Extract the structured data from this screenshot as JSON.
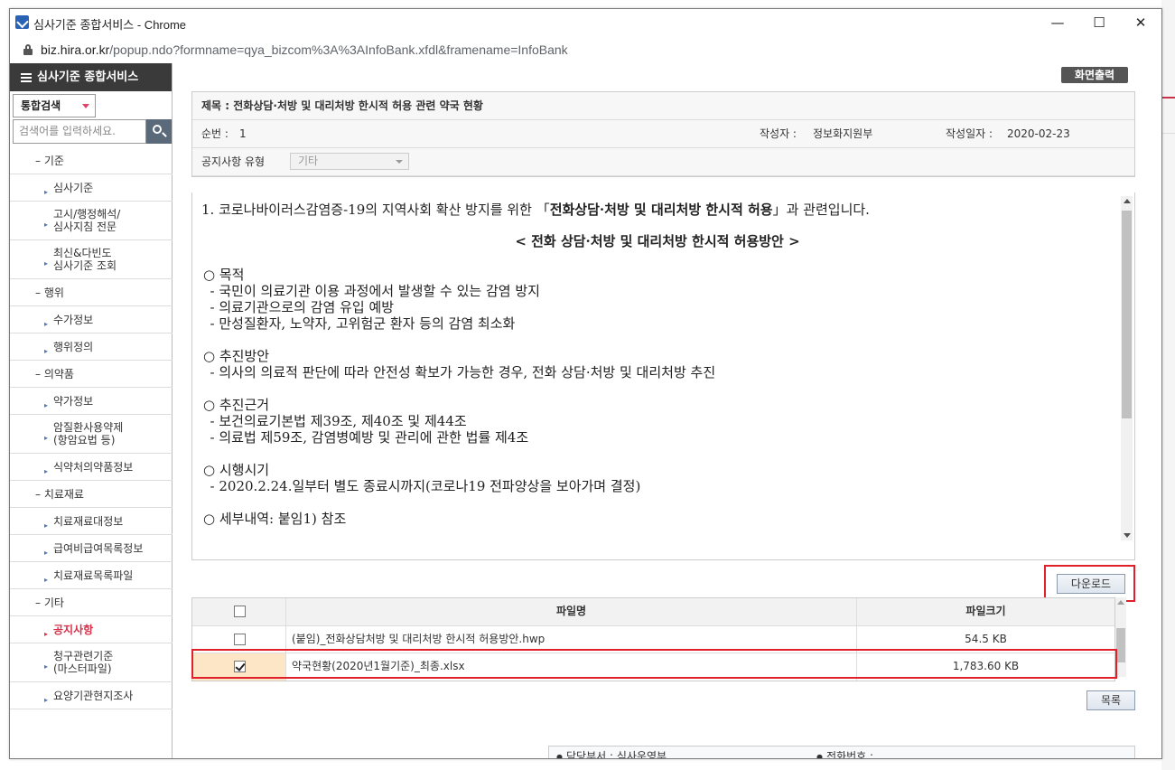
{
  "window": {
    "title": "심사기준 종합서비스 - Chrome",
    "url_host": "biz.hira.or.kr",
    "url_path": "/popup.ndo?formname=qya_bizcom%3A%3AInfoBank.xfdl&framename=InfoBank",
    "minimize": "—",
    "maximize": "☐",
    "close": "✕"
  },
  "sidebar": {
    "header": "심사기준 종합서비스",
    "search_type": "통합검색",
    "search_placeholder": "검색어를 입력하세요.",
    "items": [
      {
        "label": "– 기준",
        "kind": "cat"
      },
      {
        "label": "심사기준",
        "kind": "sub"
      },
      {
        "label": "고시/행정해석/\n심사지침 전문",
        "kind": "sub2"
      },
      {
        "label": "최신&다빈도\n심사기준 조회",
        "kind": "sub2"
      },
      {
        "label": "– 행위",
        "kind": "cat"
      },
      {
        "label": "수가정보",
        "kind": "sub"
      },
      {
        "label": "행위정의",
        "kind": "sub"
      },
      {
        "label": "– 의약품",
        "kind": "cat"
      },
      {
        "label": "약가정보",
        "kind": "sub"
      },
      {
        "label": "암질환사용약제\n(항암요법 등)",
        "kind": "sub2"
      },
      {
        "label": "식약처의약품정보",
        "kind": "sub"
      },
      {
        "label": "– 치료재료",
        "kind": "cat"
      },
      {
        "label": "치료재료대정보",
        "kind": "sub"
      },
      {
        "label": "급여비급여목록정보",
        "kind": "sub"
      },
      {
        "label": "치료재료목록파일",
        "kind": "sub"
      },
      {
        "label": "– 기타",
        "kind": "cat"
      },
      {
        "label": "공지사항",
        "kind": "sub",
        "active": true
      },
      {
        "label": "청구관련기준\n(마스터파일)",
        "kind": "sub2"
      },
      {
        "label": "요양기관현지조사",
        "kind": "sub"
      }
    ]
  },
  "main": {
    "print_button": "화면출력",
    "title_label": "제목 :",
    "title_value": "전화상담·처방 및 대리처방 한시적 허용 관련 약국 현황",
    "seq_label": "순번 :",
    "seq_value": "1",
    "author_label": "작성자 :",
    "author_value": "정보화지원부",
    "date_label": "작성일자 :",
    "date_value": "2020-02-23",
    "notice_type_label": "공지사항 유형",
    "notice_type_value": "기타",
    "body": {
      "line1_pre": "1. 코로나바이러스감염증-19의 지역사회 확산 방지를 위한 「",
      "line1_bold": "전화상담·처방 및 대리처방 한시적 허용",
      "line1_post": "」과 관련입니다.",
      "heading": "< 전화 상담·처방 및 대리처방 한시적 허용방안 >",
      "s1_title": "○ 목적",
      "s1_l1": "  - 국민이 의료기관 이용 과정에서 발생할 수 있는 감염 방지",
      "s1_l2": "  - 의료기관으로의 감염 유입 예방",
      "s1_l3": "  - 만성질환자, 노약자, 고위험군 환자 등의 감염 최소화",
      "s2_title": "○ 추진방안",
      "s2_l1": "  - 의사의 의료적 판단에 따라 안전성 확보가 가능한 경우, 전화 상담·처방 및 대리처방 추진",
      "s3_title": "○ 추진근거",
      "s3_l1": "  - 보건의료기본법 제39조, 제40조 및 제44조",
      "s3_l2": "  - 의료법 제59조, 감염병예방 및 관리에 관한 법률 제4조",
      "s4_title": "○ 시행시기",
      "s4_l1": "  - 2020.2.24.일부터 별도 종료시까지(코로나19 전파양상을 보아가며 결정)",
      "s5_title": "○ 세부내역: 붙임1) 참조"
    },
    "download_button": "다운로드",
    "file_table": {
      "col_name": "파일명",
      "col_size": "파일크기",
      "rows": [
        {
          "name": "(붙임)_전화상담처방 및 대리처방 한시적 허용방안.hwp",
          "size": "54.5 KB",
          "checked": false
        },
        {
          "name": "약국현황(2020년1월기준)_최종.xlsx",
          "size": "1,783.60 KB",
          "checked": true
        }
      ]
    },
    "list_button": "목록",
    "footer": {
      "dept_label": "담당부서 :",
      "dept_value": "심사운영부",
      "phone_label": "전화번호 :",
      "phone_value": ""
    }
  }
}
